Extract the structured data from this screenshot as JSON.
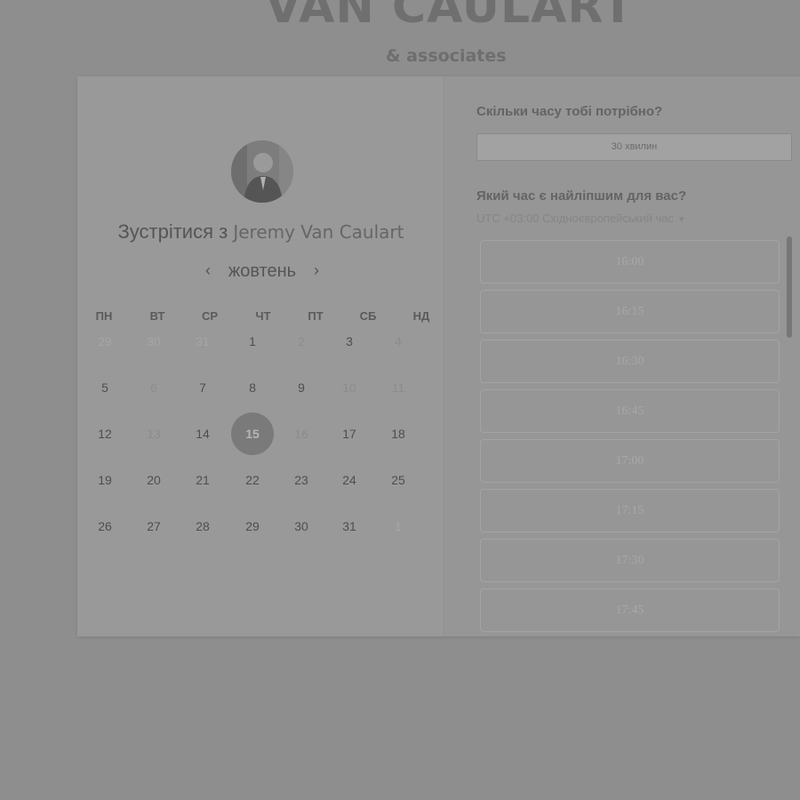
{
  "brand": {
    "name": "VAN CAULART",
    "sub": "& associates"
  },
  "left": {
    "meet_prefix": "Зустрітися з",
    "host": "Jeremy Van Caulart",
    "month": "жовтень",
    "prev_icon": "chevron-left-icon",
    "next_icon": "chevron-right-icon",
    "weekdays": [
      "ПН",
      "ВТ",
      "СР",
      "ЧТ",
      "ПТ",
      "СБ",
      "НД"
    ],
    "weeks": [
      [
        "29",
        "30",
        "31",
        "1",
        "2",
        "3",
        "4"
      ],
      [
        "5",
        "6",
        "7",
        "8",
        "9",
        "10",
        "11"
      ],
      [
        "12",
        "13",
        "14",
        "15",
        "16",
        "17",
        "18"
      ],
      [
        "19",
        "20",
        "21",
        "22",
        "23",
        "24",
        "25"
      ],
      [
        "26",
        "27",
        "28",
        "29",
        "30",
        "31",
        "1"
      ]
    ],
    "selected_day": "15"
  },
  "right": {
    "q_duration": "Скільки часу тобі потрібно?",
    "duration": "30 хвилин",
    "q_time": "Який час є найліпшим для вас?",
    "timezone": "UTC +03:00 Східноєвропейський час",
    "slots": [
      "16:00",
      "16:15",
      "16:30",
      "16:45",
      "17:00",
      "17:15",
      "17:30",
      "17:45"
    ]
  }
}
